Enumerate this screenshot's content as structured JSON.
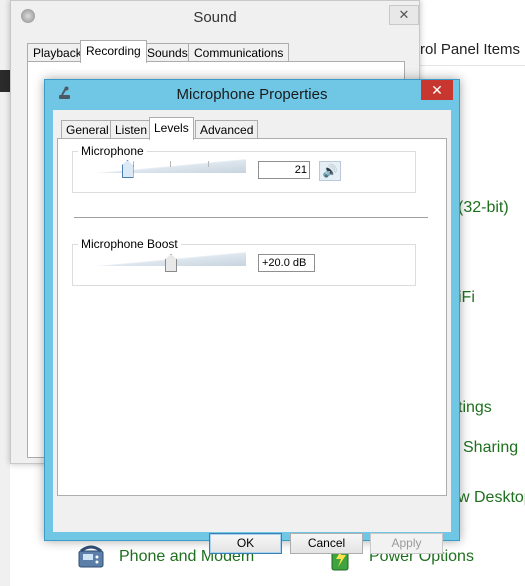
{
  "control_panel": {
    "breadcrumb": "rol Panel Items",
    "links": [
      "(32-bit)",
      "iFi",
      "tings",
      "Sharing",
      "w Desktop"
    ],
    "bottom_items": [
      "Phone and Modem",
      "Power Options"
    ]
  },
  "sound_window": {
    "title": "Sound",
    "tabs": [
      "Playback",
      "Recording",
      "Sounds",
      "Communications"
    ],
    "active_tab": "Recording",
    "close_glyph": "✕"
  },
  "mic_dialog": {
    "title": "Microphone Properties",
    "close_glyph": "✕",
    "tabs": [
      "General",
      "Listen",
      "Levels",
      "Advanced"
    ],
    "active_tab": "Levels",
    "microphone": {
      "label": "Microphone",
      "value": "21",
      "level_fraction": 0.21,
      "speaker_icon": "speaker-icon",
      "speaker_glyph": "🔊"
    },
    "boost": {
      "label": "Microphone Boost",
      "value": "+20.0 dB",
      "level_fraction": 0.5
    },
    "buttons": {
      "ok": "OK",
      "cancel": "Cancel",
      "apply": "Apply"
    }
  },
  "colors": {
    "dialog_frame": "#6fc7e5",
    "close_button": "#c7372f",
    "link_green": "#1e6f1e"
  }
}
